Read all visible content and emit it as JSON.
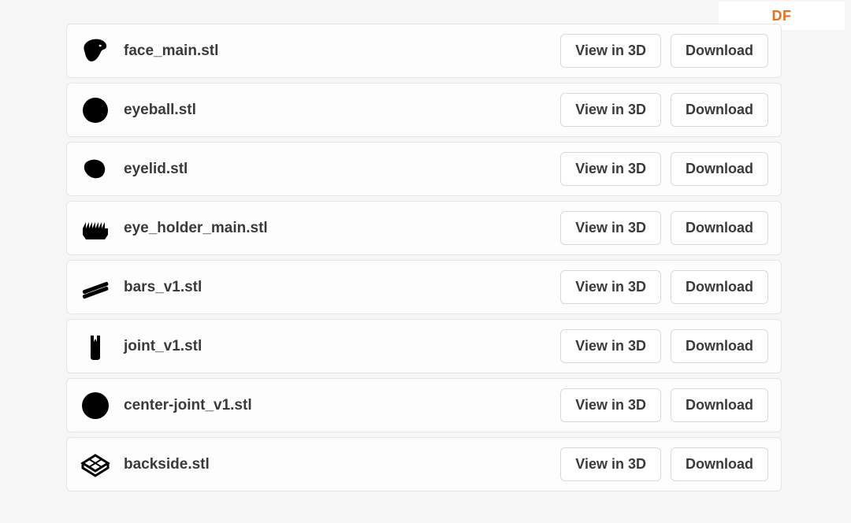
{
  "badge": "DF",
  "buttons": {
    "view": "View in 3D",
    "download": "Download"
  },
  "files": [
    {
      "name": "face_main.stl",
      "icon": "face"
    },
    {
      "name": "eyeball.stl",
      "icon": "ball"
    },
    {
      "name": "eyelid.stl",
      "icon": "eyelid"
    },
    {
      "name": "eye_holder_main.stl",
      "icon": "holder"
    },
    {
      "name": "bars_v1.stl",
      "icon": "bars"
    },
    {
      "name": "joint_v1.stl",
      "icon": "joint"
    },
    {
      "name": "center-joint_v1.stl",
      "icon": "ball"
    },
    {
      "name": "backside.stl",
      "icon": "plate"
    }
  ]
}
